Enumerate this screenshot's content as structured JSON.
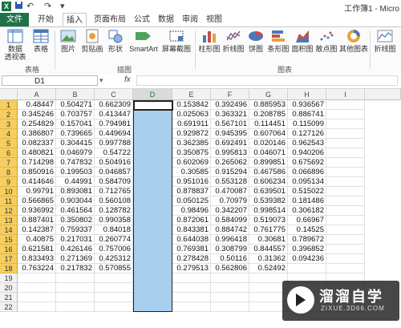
{
  "titlebar": {
    "app_icon": "X",
    "title": "工作簿1 - Micro"
  },
  "tabs": [
    "文件",
    "开始",
    "插入",
    "页面布局",
    "公式",
    "数据",
    "审阅",
    "视图"
  ],
  "active_tab": "插入",
  "ribbon": {
    "buttons": [
      {
        "label": "数据",
        "label2": "透视表",
        "icon": "pivot-table-icon"
      },
      {
        "label": "表格",
        "label2": "",
        "icon": "table-icon"
      },
      {
        "label": "图片",
        "label2": "",
        "icon": "picture-icon"
      },
      {
        "label": "剪贴画",
        "label2": "",
        "icon": "clipart-icon"
      },
      {
        "label": "形状",
        "label2": "",
        "icon": "shapes-icon"
      },
      {
        "label": "SmartArt",
        "label2": "",
        "icon": "smartart-icon"
      },
      {
        "label": "屏幕截图",
        "label2": "",
        "icon": "screenshot-icon"
      },
      {
        "label": "柱形图",
        "label2": "",
        "icon": "column-chart-icon"
      },
      {
        "label": "折线图",
        "label2": "",
        "icon": "line-chart-icon"
      },
      {
        "label": "饼图",
        "label2": "",
        "icon": "pie-chart-icon"
      },
      {
        "label": "条形图",
        "label2": "",
        "icon": "bar-chart-icon"
      },
      {
        "label": "面积图",
        "label2": "",
        "icon": "area-chart-icon"
      },
      {
        "label": "散点图",
        "label2": "",
        "icon": "scatter-chart-icon"
      },
      {
        "label": "其他图表",
        "label2": "",
        "icon": "other-charts-icon"
      },
      {
        "label": "折线图",
        "label2": "",
        "icon": "sparkline-icon"
      }
    ],
    "groups": [
      "表格",
      "插图",
      "图表"
    ]
  },
  "formula_bar": {
    "name_box": "D1",
    "fx": "fx"
  },
  "columns": [
    "A",
    "B",
    "C",
    "D",
    "E",
    "F",
    "G",
    "H",
    "I"
  ],
  "selected_column": "D",
  "rows": [
    [
      "0.48447",
      "0.504271",
      "0.662309",
      "0.153842",
      "0.392496",
      "0.885953",
      "0.936567"
    ],
    [
      "0.345246",
      "0.703757",
      "0.413447",
      "0.025063",
      "0.363321",
      "0.208785",
      "0.886741"
    ],
    [
      "0.254829",
      "0.157041",
      "0.794981",
      "0.691911",
      "0.567101",
      "0.114451",
      "0.115099"
    ],
    [
      "0.386807",
      "0.739665",
      "0.449694",
      "0.929872",
      "0.945395",
      "0.607064",
      "0.127126"
    ],
    [
      "0.082337",
      "0.304415",
      "0.997788",
      "0.362385",
      "0.692491",
      "0.020146",
      "0.962543"
    ],
    [
      "0.480821",
      "0.046979",
      "0.54722",
      "0.350875",
      "0.995813",
      "0.046071",
      "0.940206"
    ],
    [
      "0.714298",
      "0.747832",
      "0.504916",
      "0.602069",
      "0.265062",
      "0.899851",
      "0.675692"
    ],
    [
      "0.850916",
      "0.199503",
      "0.046857",
      "0.30585",
      "0.915294",
      "0.467586",
      "0.066896"
    ],
    [
      "0.414646",
      "0.44991",
      "0.584709",
      "0.951016",
      "0.553128",
      "0.606234",
      "0.095134"
    ],
    [
      "0.99791",
      "0.893081",
      "0.712765",
      "0.878837",
      "0.470087",
      "0.639501",
      "0.515022"
    ],
    [
      "0.566865",
      "0.903044",
      "0.560108",
      "0.050125",
      "0.70979",
      "0.539382",
      "0.181486"
    ],
    [
      "0.936992",
      "0.461564",
      "0.128782",
      "0.98496",
      "0.342207",
      "0.998514",
      "0.306182"
    ],
    [
      "0.887401",
      "0.350802",
      "0.990358",
      "0.872061",
      "0.584099",
      "0.519073",
      "0.66967"
    ],
    [
      "0.142387",
      "0.759337",
      "0.84018",
      "0.843381",
      "0.884742",
      "0.761775",
      "0.14525"
    ],
    [
      "0.40875",
      "0.217031",
      "0.260774",
      "0.644038",
      "0.996418",
      "0.30681",
      "0.789672"
    ],
    [
      "0.621581",
      "0.426146",
      "0.757006",
      "0.769381",
      "0.308799",
      "0.844557",
      "0.396852"
    ],
    [
      "0.833493",
      "0.271369",
      "0.425312",
      "0.278428",
      "0.50116",
      "0.31362",
      "0.094236"
    ],
    [
      "0.763224",
      "0.217832",
      "0.570855",
      "0.279513",
      "0.562806",
      "0.52492",
      ""
    ]
  ],
  "row_numbers": [
    "1",
    "2",
    "3",
    "4",
    "5",
    "6",
    "7",
    "8",
    "9",
    "10",
    "11",
    "12",
    "13",
    "14",
    "15",
    "16",
    "17",
    "18",
    "19",
    "20",
    "21",
    "22"
  ],
  "watermark": {
    "text": "溜溜自学",
    "sub": "ZIXUE.3D66.COM"
  }
}
